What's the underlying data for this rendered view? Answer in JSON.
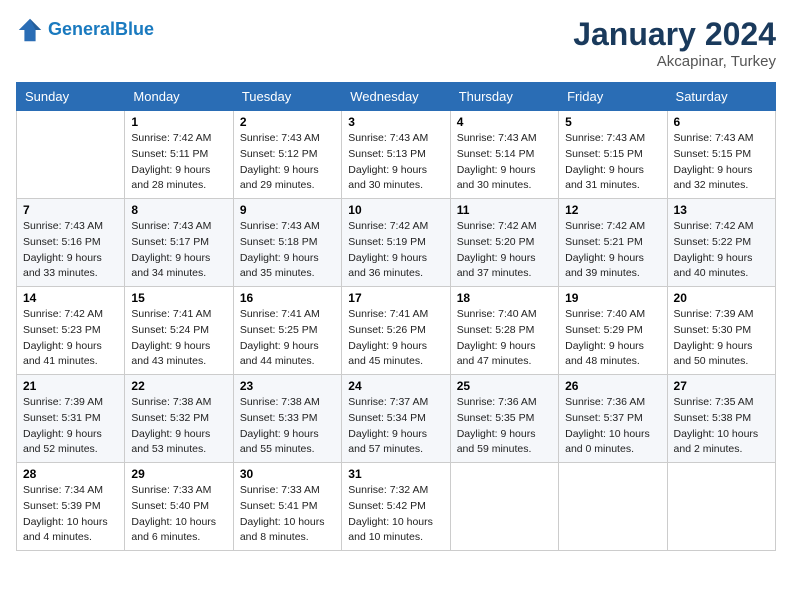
{
  "app": {
    "name": "GeneralBlue",
    "logo_text_1": "General",
    "logo_text_2": "Blue"
  },
  "calendar": {
    "month": "January 2024",
    "location": "Akcapinar, Turkey",
    "days_of_week": [
      "Sunday",
      "Monday",
      "Tuesday",
      "Wednesday",
      "Thursday",
      "Friday",
      "Saturday"
    ],
    "weeks": [
      [
        {
          "day": "",
          "info": ""
        },
        {
          "day": "1",
          "info": "Sunrise: 7:42 AM\nSunset: 5:11 PM\nDaylight: 9 hours\nand 28 minutes."
        },
        {
          "day": "2",
          "info": "Sunrise: 7:43 AM\nSunset: 5:12 PM\nDaylight: 9 hours\nand 29 minutes."
        },
        {
          "day": "3",
          "info": "Sunrise: 7:43 AM\nSunset: 5:13 PM\nDaylight: 9 hours\nand 30 minutes."
        },
        {
          "day": "4",
          "info": "Sunrise: 7:43 AM\nSunset: 5:14 PM\nDaylight: 9 hours\nand 30 minutes."
        },
        {
          "day": "5",
          "info": "Sunrise: 7:43 AM\nSunset: 5:15 PM\nDaylight: 9 hours\nand 31 minutes."
        },
        {
          "day": "6",
          "info": "Sunrise: 7:43 AM\nSunset: 5:15 PM\nDaylight: 9 hours\nand 32 minutes."
        }
      ],
      [
        {
          "day": "7",
          "info": "Sunrise: 7:43 AM\nSunset: 5:16 PM\nDaylight: 9 hours\nand 33 minutes."
        },
        {
          "day": "8",
          "info": "Sunrise: 7:43 AM\nSunset: 5:17 PM\nDaylight: 9 hours\nand 34 minutes."
        },
        {
          "day": "9",
          "info": "Sunrise: 7:43 AM\nSunset: 5:18 PM\nDaylight: 9 hours\nand 35 minutes."
        },
        {
          "day": "10",
          "info": "Sunrise: 7:42 AM\nSunset: 5:19 PM\nDaylight: 9 hours\nand 36 minutes."
        },
        {
          "day": "11",
          "info": "Sunrise: 7:42 AM\nSunset: 5:20 PM\nDaylight: 9 hours\nand 37 minutes."
        },
        {
          "day": "12",
          "info": "Sunrise: 7:42 AM\nSunset: 5:21 PM\nDaylight: 9 hours\nand 39 minutes."
        },
        {
          "day": "13",
          "info": "Sunrise: 7:42 AM\nSunset: 5:22 PM\nDaylight: 9 hours\nand 40 minutes."
        }
      ],
      [
        {
          "day": "14",
          "info": "Sunrise: 7:42 AM\nSunset: 5:23 PM\nDaylight: 9 hours\nand 41 minutes."
        },
        {
          "day": "15",
          "info": "Sunrise: 7:41 AM\nSunset: 5:24 PM\nDaylight: 9 hours\nand 43 minutes."
        },
        {
          "day": "16",
          "info": "Sunrise: 7:41 AM\nSunset: 5:25 PM\nDaylight: 9 hours\nand 44 minutes."
        },
        {
          "day": "17",
          "info": "Sunrise: 7:41 AM\nSunset: 5:26 PM\nDaylight: 9 hours\nand 45 minutes."
        },
        {
          "day": "18",
          "info": "Sunrise: 7:40 AM\nSunset: 5:28 PM\nDaylight: 9 hours\nand 47 minutes."
        },
        {
          "day": "19",
          "info": "Sunrise: 7:40 AM\nSunset: 5:29 PM\nDaylight: 9 hours\nand 48 minutes."
        },
        {
          "day": "20",
          "info": "Sunrise: 7:39 AM\nSunset: 5:30 PM\nDaylight: 9 hours\nand 50 minutes."
        }
      ],
      [
        {
          "day": "21",
          "info": "Sunrise: 7:39 AM\nSunset: 5:31 PM\nDaylight: 9 hours\nand 52 minutes."
        },
        {
          "day": "22",
          "info": "Sunrise: 7:38 AM\nSunset: 5:32 PM\nDaylight: 9 hours\nand 53 minutes."
        },
        {
          "day": "23",
          "info": "Sunrise: 7:38 AM\nSunset: 5:33 PM\nDaylight: 9 hours\nand 55 minutes."
        },
        {
          "day": "24",
          "info": "Sunrise: 7:37 AM\nSunset: 5:34 PM\nDaylight: 9 hours\nand 57 minutes."
        },
        {
          "day": "25",
          "info": "Sunrise: 7:36 AM\nSunset: 5:35 PM\nDaylight: 9 hours\nand 59 minutes."
        },
        {
          "day": "26",
          "info": "Sunrise: 7:36 AM\nSunset: 5:37 PM\nDaylight: 10 hours\nand 0 minutes."
        },
        {
          "day": "27",
          "info": "Sunrise: 7:35 AM\nSunset: 5:38 PM\nDaylight: 10 hours\nand 2 minutes."
        }
      ],
      [
        {
          "day": "28",
          "info": "Sunrise: 7:34 AM\nSunset: 5:39 PM\nDaylight: 10 hours\nand 4 minutes."
        },
        {
          "day": "29",
          "info": "Sunrise: 7:33 AM\nSunset: 5:40 PM\nDaylight: 10 hours\nand 6 minutes."
        },
        {
          "day": "30",
          "info": "Sunrise: 7:33 AM\nSunset: 5:41 PM\nDaylight: 10 hours\nand 8 minutes."
        },
        {
          "day": "31",
          "info": "Sunrise: 7:32 AM\nSunset: 5:42 PM\nDaylight: 10 hours\nand 10 minutes."
        },
        {
          "day": "",
          "info": ""
        },
        {
          "day": "",
          "info": ""
        },
        {
          "day": "",
          "info": ""
        }
      ]
    ]
  }
}
